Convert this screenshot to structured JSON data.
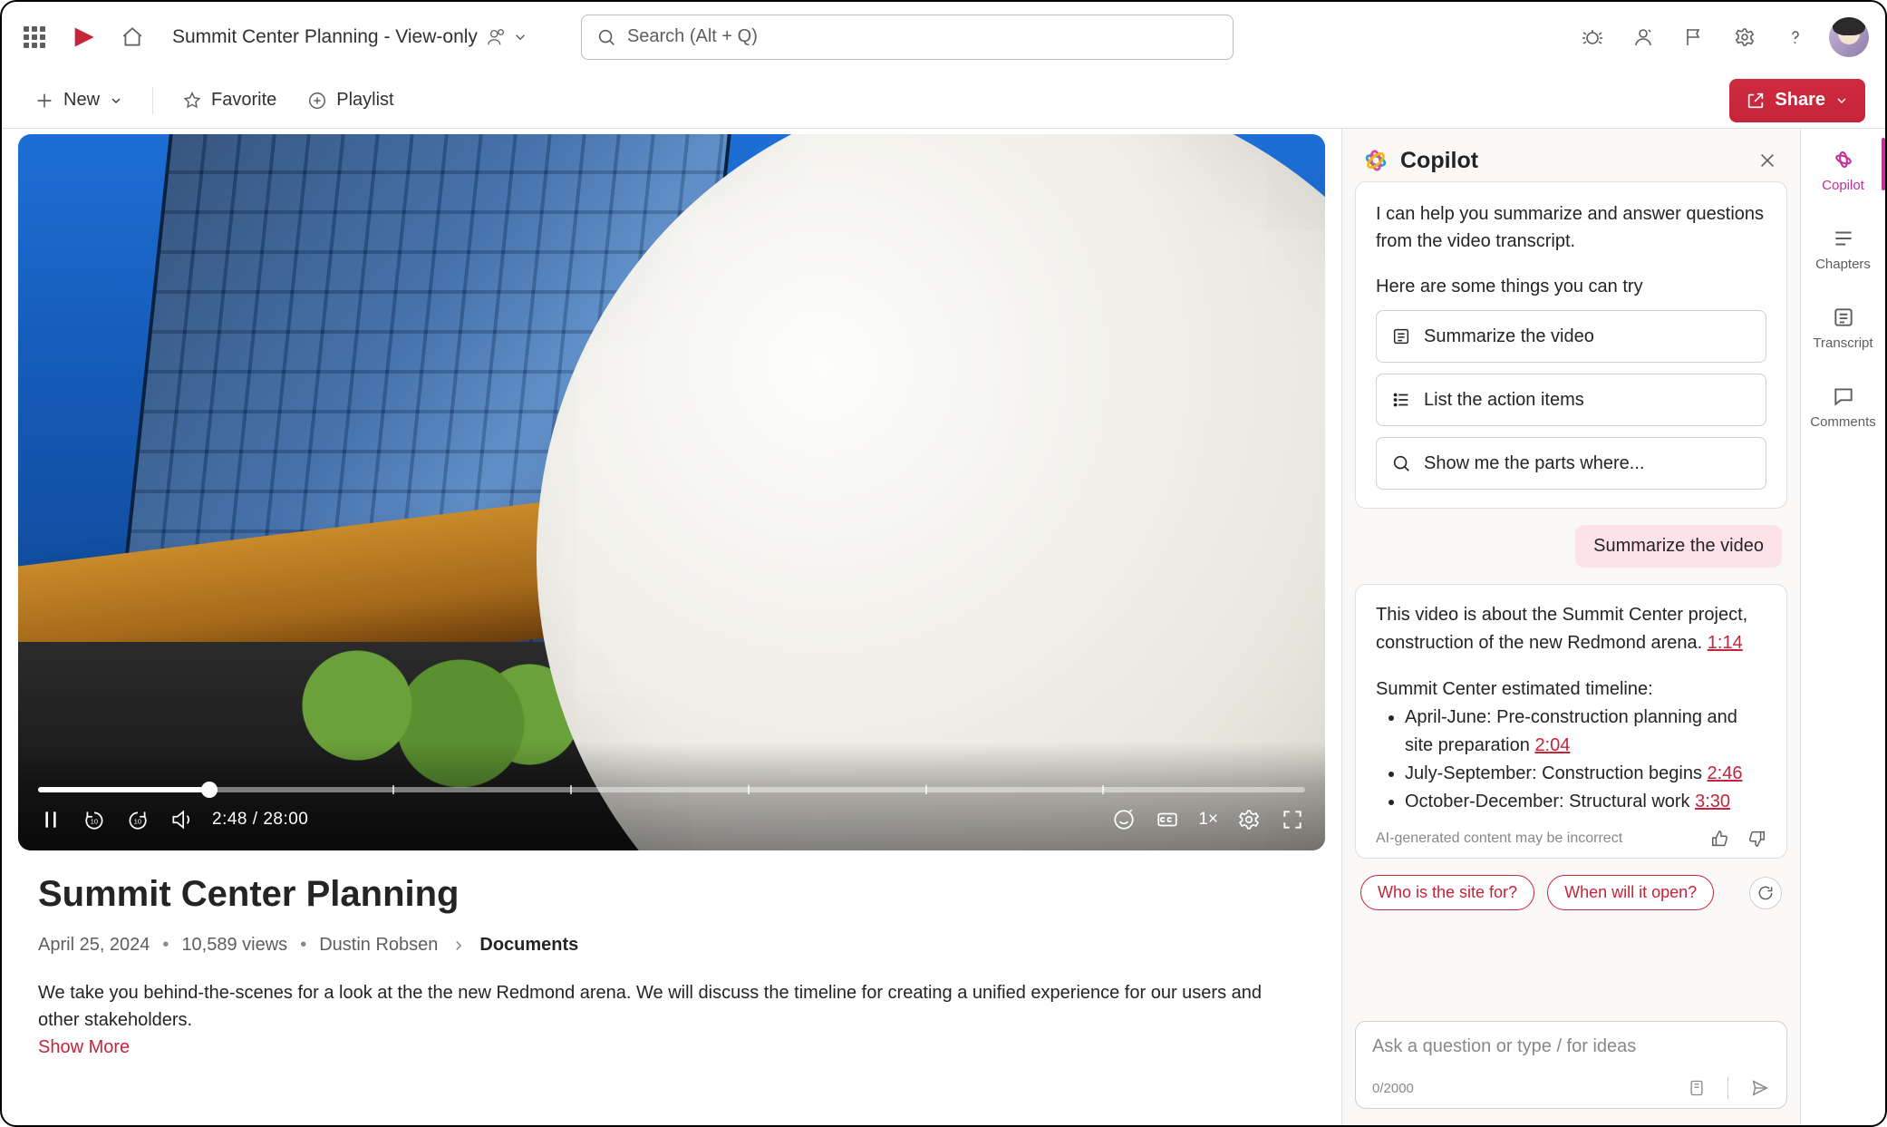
{
  "header": {
    "doc_title": "Summit Center Planning - View-only",
    "search_placeholder": "Search (Alt + Q)"
  },
  "toolbar": {
    "new_label": "New",
    "favorite_label": "Favorite",
    "playlist_label": "Playlist",
    "share_label": "Share"
  },
  "rail": {
    "copilot": "Copilot",
    "chapters": "Chapters",
    "transcript": "Transcript",
    "comments": "Comments"
  },
  "player": {
    "time_current": "2:48",
    "time_total": "28:00",
    "speed": "1×"
  },
  "meta": {
    "title": "Summit Center Planning",
    "date": "April 25, 2024",
    "views": "10,589 views",
    "author": "Dustin Robsen",
    "folder": "Documents",
    "description": "We take you behind-the-scenes for a look at the the new Redmond arena. We will discuss the timeline for creating a unified experience for our users and other stakeholders.",
    "show_more": "Show More"
  },
  "copilot": {
    "title": "Copilot",
    "intro": "I can help you summarize and answer questions from the video transcript.",
    "try_label": "Here are some things you can try",
    "suggestions": {
      "summarize": "Summarize the video",
      "actions": "List the action items",
      "parts": "Show me the parts where..."
    },
    "user_msg": "Summarize the video",
    "ai_summary": "This video is about the Summit Center project, construction of the new Redmond arena.",
    "ai_summary_ts": "1:14",
    "timeline_head": "Summit Center estimated timeline:",
    "timeline": [
      {
        "text": "April-June: Pre-construction planning and site preparation",
        "ts": "2:04"
      },
      {
        "text": "July-September: Construction begins",
        "ts": "2:46"
      },
      {
        "text": "October-December: Structural work",
        "ts": "3:30"
      }
    ],
    "disclaimer": "AI-generated content may be incorrect",
    "followups": {
      "who": "Who is the site for?",
      "when": "When will it open?"
    },
    "input_placeholder": "Ask a question or type / for ideas",
    "char_count": "0/2000"
  }
}
